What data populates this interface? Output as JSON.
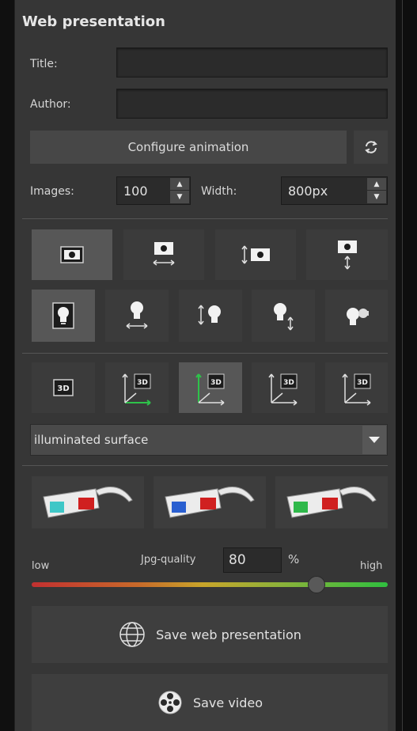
{
  "panel": {
    "title": "Web presentation"
  },
  "fields": {
    "title_label": "Title:",
    "title_value": "",
    "author_label": "Author:",
    "author_value": ""
  },
  "animation": {
    "configure_label": "Configure animation",
    "refresh_icon": "refresh-icon"
  },
  "images": {
    "label": "Images:",
    "value": "100"
  },
  "width": {
    "label": "Width:",
    "value": "800px"
  },
  "camera_modes": [
    "camera-static-icon",
    "camera-pan-horizontal-icon",
    "camera-pan-vertical-left-icon",
    "camera-pan-vertical-icon"
  ],
  "light_modes": [
    "light-static-icon",
    "light-move-horizontal-icon",
    "light-move-vertical-left-icon",
    "light-move-vertical-icon",
    "light-rotate-icon"
  ],
  "view3d_modes": [
    "view-3d-icon",
    "view-3d-axis-green-x-icon",
    "view-3d-axis-green-xy-icon",
    "view-3d-axis-gray-icon",
    "view-3d-axis-gray-2-icon"
  ],
  "surface_select": {
    "value": "illuminated surface"
  },
  "glasses": [
    "anaglyph-cyan-red-icon",
    "anaglyph-blue-red-icon",
    "anaglyph-green-red-icon"
  ],
  "quality": {
    "low": "low",
    "label": "Jpg-quality",
    "value": "80",
    "unit": "%",
    "high": "high",
    "level": 80
  },
  "actions": {
    "save_web": "Save web presentation",
    "save_video": "Save video"
  },
  "colors": {
    "panel_bg": "#363636",
    "slider_low": "#c23030",
    "slider_high": "#2fbf3f"
  }
}
